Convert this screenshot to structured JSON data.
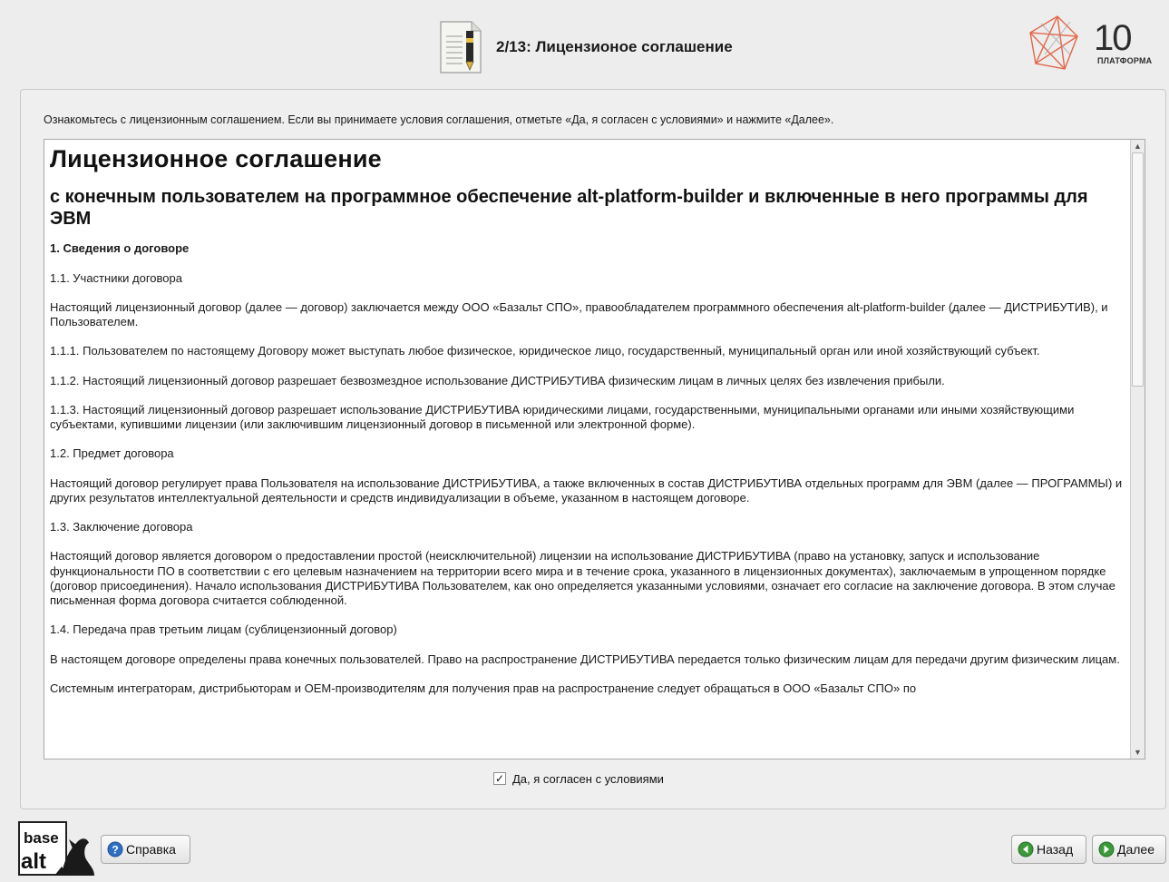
{
  "header": {
    "title": "2/13: Лицензионое соглашение",
    "logo_number": "10",
    "logo_subtitle": "ПЛАТФОРМА"
  },
  "main": {
    "instruction": "Ознакомьтесь с лицензионным соглашением. Если вы принимаете условия соглашения, отметьте «Да, я согласен с условиями» и нажмите «Далее».",
    "license": {
      "heading": "Лицензионное соглашение",
      "subheading": "с конечным пользователем на программное обеспечение alt-platform-builder и включенные в него программы для ЭВМ",
      "section_1": "1. Сведения о договоре",
      "paragraphs": [
        "1.1. Участники договора",
        "Настоящий лицензионный договор (далее — договор) заключается между ООО «Базальт СПО», правообладателем программного обеспечения alt-platform-builder (далее — ДИСТРИБУТИВ), и Пользователем.",
        "1.1.1. Пользователем по настоящему Договору может выступать любое физическое, юридическое лицо, государственный, муниципальный орган или иной хозяйствующий субъект.",
        "1.1.2. Настоящий лицензионный договор разрешает безвозмездное использование ДИСТРИБУТИВА физическим лицам в личных целях без извлечения прибыли.",
        "1.1.3. Настоящий лицензионный договор разрешает использование ДИСТРИБУТИВА юридическими лицами, государственными, муниципальными органами или иными хозяйствующими субъектами, купившими лицензии (или заключившим лицензионный договор в письменной или электронной форме).",
        "1.2. Предмет договора",
        "Настоящий договор регулирует права Пользователя на использование ДИСТРИБУТИВА, а также включенных в состав ДИСТРИБУТИВА отдельных программ для ЭВМ (далее — ПРОГРАММЫ) и других результатов интеллектуальной деятельности и средств индивидуализации в объеме, указанном в настоящем договоре.",
        "1.3. Заключение договора",
        "Настоящий договор является договором о предоставлении простой (неисключительной) лицензии на использование ДИСТРИБУТИВА (право на установку, запуск и использование функциональности ПО в соответствии с его целевым назначением на территории всего мира и в течение срока, указанного в лицензионных документах), заключаемым в упрощенном порядке (договор присоединения). Начало использования ДИСТРИБУТИВА Пользователем, как оно определяется указанными условиями, означает его согласие на заключение договора. В этом случае письменная форма договора считается соблюденной.",
        "1.4. Передача прав третьим лицам (сублицензионный договор)",
        "В настоящем договоре определены права конечных пользователей. Право на распространение ДИСТРИБУТИВА передается только физическим лицам для передачи другим физическим лицам.",
        "Системным интеграторам, дистрибьюторам и OEM-производителям для получения прав на распространение следует обращаться в ООО «Базальт СПО» по"
      ]
    },
    "agree_checked": true,
    "agree_mark": "✓",
    "agree_label": "Да, я согласен с условиями"
  },
  "footer": {
    "brand_top": "base",
    "brand_bottom": "alt",
    "help_label": "Справка",
    "back_label": "Назад",
    "next_label": "Далее"
  },
  "colors": {
    "background": "#ededed",
    "help_icon": "#2f6fc4",
    "nav_icon": "#3a9a3a",
    "logo_accent": "#e2502e"
  },
  "icons": [
    "document-pen-icon",
    "platform-logo",
    "help-icon",
    "back-arrow-icon",
    "next-arrow-icon",
    "basealt-mascot-logo"
  ]
}
